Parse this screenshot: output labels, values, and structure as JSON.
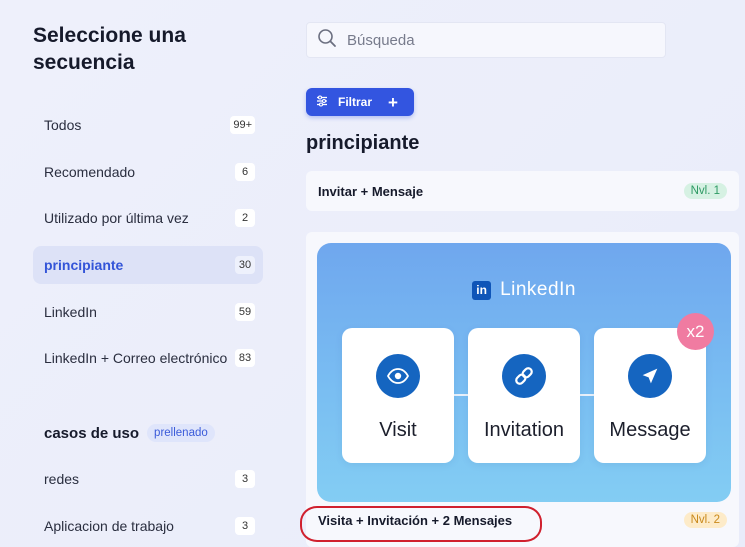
{
  "sidebar": {
    "title": "Seleccione una secuencia",
    "sequences": [
      {
        "label": "Todos",
        "count": "99+"
      },
      {
        "label": "Recomendado",
        "count": "6"
      },
      {
        "label": "Utilizado por última vez",
        "count": "2"
      },
      {
        "label": "principiante",
        "count": "30",
        "active": true
      },
      {
        "label": "LinkedIn",
        "count": "59"
      },
      {
        "label": "LinkedIn + Correo electrónico",
        "count": "83"
      }
    ],
    "use_cases_title": "casos de uso",
    "prefill_badge": "prellenado",
    "use_cases": [
      {
        "label": "redes",
        "count": "3"
      },
      {
        "label": "Aplicacion de trabajo",
        "count": "3"
      }
    ]
  },
  "search": {
    "placeholder": "Búsqueda",
    "value": ""
  },
  "filter_button": {
    "label": "Filtrar",
    "icon": "sliders-icon"
  },
  "section_title": "principiante",
  "cards": [
    {
      "title": "Invitar + Mensaje",
      "level": "Nvl. 1"
    },
    {
      "title": "Visita + Invitación + 2 Mensajes",
      "level": "Nvl. 2",
      "preview": {
        "brand": "LinkedIn",
        "steps": [
          {
            "label": "Visit",
            "icon": "eye-icon"
          },
          {
            "label": "Invitation",
            "icon": "link-icon"
          },
          {
            "label": "Message",
            "icon": "send-icon"
          }
        ],
        "multiplier": "x2"
      }
    }
  ],
  "colors": {
    "accent": "#3355e0",
    "linkedin_blue": "#1565c0",
    "level1": "#2e9a64",
    "level2": "#c9891c",
    "annotation": "#d0202e"
  }
}
